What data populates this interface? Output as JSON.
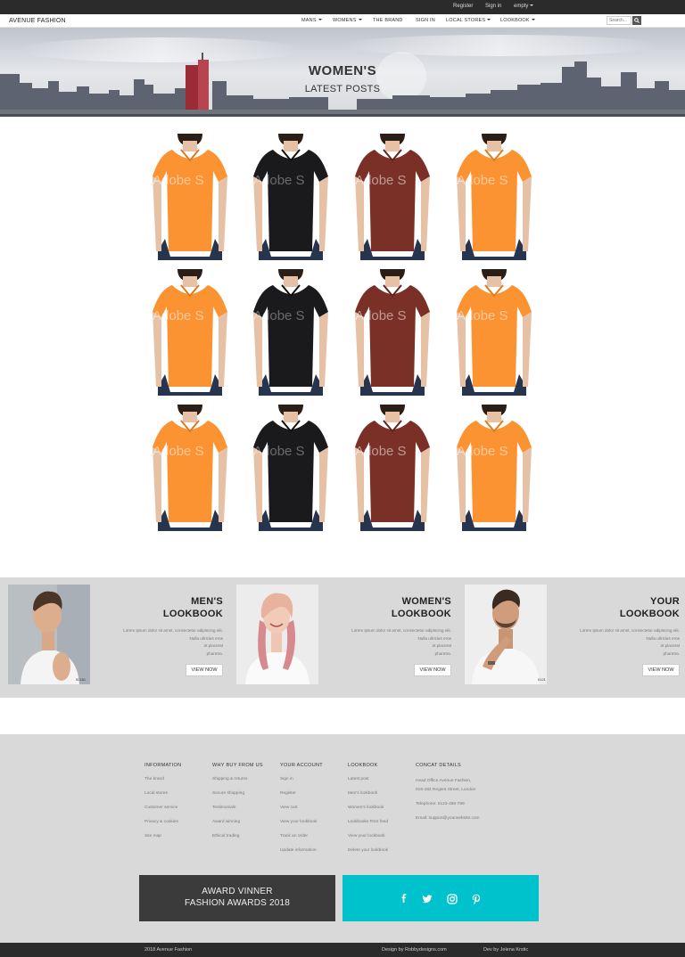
{
  "topbar": {
    "register": "Register",
    "sign_in": "Sign in",
    "cart": "empty"
  },
  "nav": {
    "brand": "AVENUE FASHION",
    "items": [
      "MANS",
      "WOMENS",
      "THE BRAND",
      "SIGN IN",
      "LOCAL STORES",
      "LOOKBOOK"
    ],
    "search_placeholder": "Search..."
  },
  "hero": {
    "title": "WOMEN'S",
    "subtitle": "LATEST POSTS"
  },
  "products": {
    "watermark": "Adobe S",
    "grid_colors": [
      [
        "#fb9333",
        "#1a1a1c",
        "#7a3026",
        "#fb9333"
      ],
      [
        "#fb9333",
        "#1a1a1c",
        "#7a3026",
        "#fb9333"
      ],
      [
        "#fb9333",
        "#1a1a1c",
        "#7a3026",
        "#fb9333"
      ]
    ]
  },
  "lookbook": {
    "description": [
      "Lorem ipsum dolor sit amet, consectetur adipiscing elit.",
      "Nulla ultricies eros",
      "at placerat",
      "pharetra."
    ],
    "button": "VIEW NOW",
    "cards": [
      {
        "title_line1": "MEN'S",
        "title_line2": "LOOKBOOK",
        "photo_tag": "92181"
      },
      {
        "title_line1": "WOMEN'S",
        "title_line2": "LOOKBOOK",
        "photo_tag": ""
      },
      {
        "title_line1": "YOUR",
        "title_line2": "LOOKBOOK",
        "photo_tag": "0121"
      }
    ]
  },
  "footer": {
    "columns": [
      {
        "heading": "INFORMATION",
        "links": [
          "The brand",
          "Local stores",
          "Customer service",
          "Privacy & cookies",
          "Site map"
        ]
      },
      {
        "heading": "WHY BUY FROM US",
        "links": [
          "Shipping & returns",
          "Secure shopping",
          "Testimonials",
          "Award winning",
          "Ethical trading"
        ]
      },
      {
        "heading": "YOUR ACCOUNT",
        "links": [
          "Sign in",
          "Register",
          "View cart",
          "View your lookbook",
          "Track an order",
          "Update information"
        ]
      },
      {
        "heading": "LOOKBOOK",
        "links": [
          "Latest post",
          "Men's lookbook",
          "Women's lookbook",
          "Lookbooks RSS feed",
          "View your lookbook",
          "Delete your lookbook"
        ]
      }
    ],
    "contact": {
      "heading": "CONCAT DETAILS",
      "address1": "Head Office Avenue Fashion,",
      "address2": "018-182 Regent Street, London",
      "phone": "Telephone: 0123-456-789",
      "email": "Email: support@yourwebsite.com"
    },
    "award_line1": "AWARD VINNER",
    "award_line2": "FASHION AWARDS 2018",
    "social_icons": [
      "facebook-icon",
      "twitter-icon",
      "instagram-icon",
      "pinterest-icon"
    ]
  },
  "bottombar": {
    "copyright": "2018 Avenue Fashion",
    "design": "Design by Robbydesigns.com",
    "dev": "Dev by Jelena Krstic"
  },
  "colors": {
    "dark_bar": "#2b2b2b",
    "band_gray": "#d9d9d9",
    "accent_teal": "#00c2cc"
  }
}
